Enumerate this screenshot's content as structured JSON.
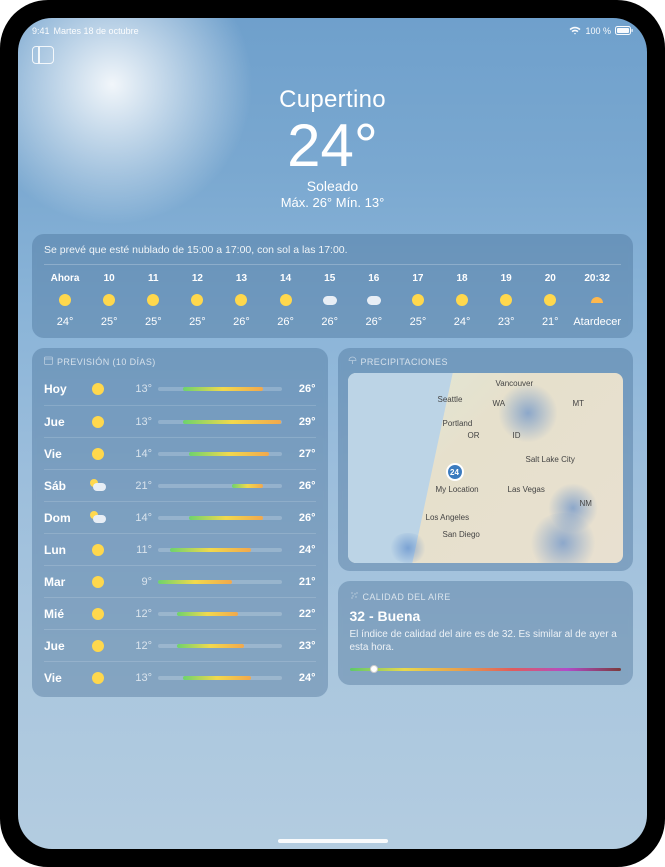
{
  "status": {
    "time": "9:41",
    "date": "Martes 18 de octubre",
    "battery": "100 %",
    "wifi_icon": "wifi"
  },
  "header": {
    "city": "Cupertino",
    "temperature": "24°",
    "condition": "Soleado",
    "hi_lo": "Máx. 26° Mín. 13°"
  },
  "hourly": {
    "summary": "Se prevé que esté nublado de 15:00 a 17:00, con sol a las 17:00.",
    "items": [
      {
        "label": "Ahora",
        "icon": "sun",
        "temp": "24°"
      },
      {
        "label": "10",
        "icon": "sun",
        "temp": "25°"
      },
      {
        "label": "11",
        "icon": "sun",
        "temp": "25°"
      },
      {
        "label": "12",
        "icon": "sun",
        "temp": "25°"
      },
      {
        "label": "13",
        "icon": "sun",
        "temp": "26°"
      },
      {
        "label": "14",
        "icon": "sun",
        "temp": "26°"
      },
      {
        "label": "15",
        "icon": "cloud",
        "temp": "26°"
      },
      {
        "label": "16",
        "icon": "cloud",
        "temp": "26°"
      },
      {
        "label": "17",
        "icon": "sun",
        "temp": "25°"
      },
      {
        "label": "18",
        "icon": "sun",
        "temp": "24°"
      },
      {
        "label": "19",
        "icon": "sun",
        "temp": "23°"
      },
      {
        "label": "20",
        "icon": "sun",
        "temp": "21°"
      },
      {
        "label": "20:32",
        "icon": "sunset",
        "temp": "Atardecer"
      }
    ]
  },
  "forecast": {
    "title": "PREVISIÓN (10 DÍAS)",
    "global_lo": 9,
    "global_hi": 29,
    "days": [
      {
        "name": "Hoy",
        "icon": "sun",
        "lo": "13°",
        "hi": "26°",
        "lo_n": 13,
        "hi_n": 26
      },
      {
        "name": "Jue",
        "icon": "sun",
        "lo": "13°",
        "hi": "29°",
        "lo_n": 13,
        "hi_n": 29
      },
      {
        "name": "Vie",
        "icon": "sun",
        "lo": "14°",
        "hi": "27°",
        "lo_n": 14,
        "hi_n": 27
      },
      {
        "name": "Sáb",
        "icon": "partly",
        "lo": "21°",
        "hi": "26°",
        "lo_n": 21,
        "hi_n": 26
      },
      {
        "name": "Dom",
        "icon": "partly",
        "lo": "14°",
        "hi": "26°",
        "lo_n": 14,
        "hi_n": 26
      },
      {
        "name": "Lun",
        "icon": "sun",
        "lo": "11°",
        "hi": "24°",
        "lo_n": 11,
        "hi_n": 24
      },
      {
        "name": "Mar",
        "icon": "sun",
        "lo": "9°",
        "hi": "21°",
        "lo_n": 9,
        "hi_n": 21
      },
      {
        "name": "Mié",
        "icon": "sun",
        "lo": "12°",
        "hi": "22°",
        "lo_n": 12,
        "hi_n": 22
      },
      {
        "name": "Jue",
        "icon": "sun",
        "lo": "12°",
        "hi": "23°",
        "lo_n": 12,
        "hi_n": 23
      },
      {
        "name": "Vie",
        "icon": "sun",
        "lo": "13°",
        "hi": "24°",
        "lo_n": 13,
        "hi_n": 24
      }
    ]
  },
  "precip": {
    "title": "PRECIPITACIONES",
    "labels": {
      "vancouver": "Vancouver",
      "seattle": "Seattle",
      "wa": "WA",
      "mt": "MT",
      "portland": "Portland",
      "or": "OR",
      "id": "ID",
      "saltlake": "Salt Lake City",
      "mylocation": "My Location",
      "lasvegas": "Las Vegas",
      "nm": "NM",
      "losangeles": "Los Angeles",
      "sandiego": "San Diego",
      "badge": "24"
    }
  },
  "air": {
    "title": "CALIDAD DEL AIRE",
    "value": "32 - Buena",
    "desc": "El índice de calidad del aire es de 32. Es similar al de ayer a esta hora.",
    "position_pct": 9
  }
}
